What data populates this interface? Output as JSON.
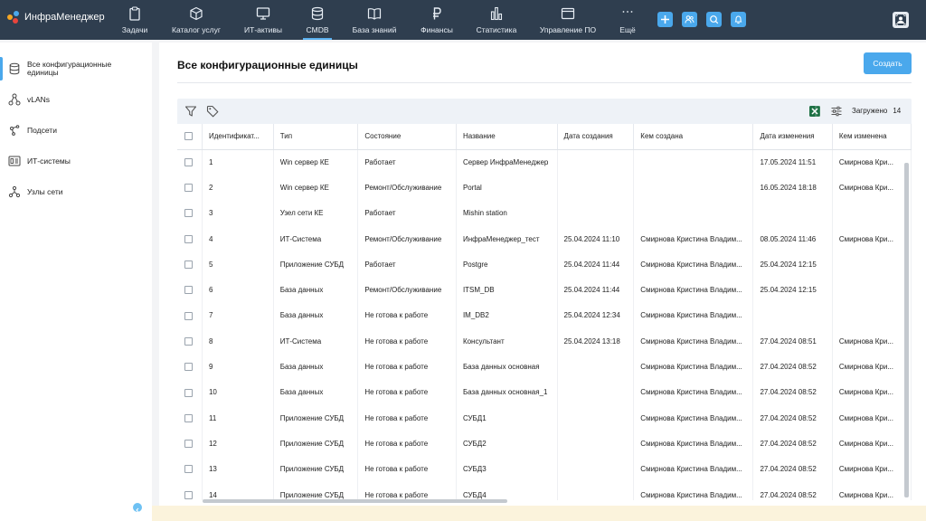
{
  "app": {
    "title": "ИнфраМенеджер"
  },
  "nav": [
    {
      "label": "Задачи",
      "icon": "clipboard-icon",
      "active": false
    },
    {
      "label": "Каталог услуг",
      "icon": "cube-icon",
      "active": false
    },
    {
      "label": "ИТ-активы",
      "icon": "monitor-icon",
      "active": false
    },
    {
      "label": "CMDB",
      "icon": "database-icon",
      "active": true
    },
    {
      "label": "База знаний",
      "icon": "book-icon",
      "active": false
    },
    {
      "label": "Финансы",
      "icon": "ruble-icon",
      "active": false
    },
    {
      "label": "Статистика",
      "icon": "bar-chart-icon",
      "active": false
    },
    {
      "label": "Управление ПО",
      "icon": "window-icon",
      "active": false
    },
    {
      "label": "Ещё",
      "icon": "more-icon",
      "active": false
    }
  ],
  "topbar_buttons": [
    "plus-icon",
    "users-icon",
    "search-icon",
    "bell-icon"
  ],
  "sidebar": {
    "items": [
      {
        "label": "Все конфигурационные единицы",
        "icon": "database-icon",
        "active": true
      },
      {
        "label": "vLANs",
        "icon": "vlan-icon",
        "active": false
      },
      {
        "label": "Подсети",
        "icon": "subnet-icon",
        "active": false
      },
      {
        "label": "ИТ-системы",
        "icon": "it-system-icon",
        "active": false
      },
      {
        "label": "Узлы сети",
        "icon": "network-node-icon",
        "active": false
      }
    ]
  },
  "main": {
    "title": "Все конфигурационные единицы",
    "create_label": "Создать",
    "loaded_label": "Загружено",
    "loaded_count": "14"
  },
  "colors": {
    "topbar": "#2f3e4f",
    "accent": "#4aa8ec",
    "excel": "#1e7145"
  },
  "table": {
    "columns": [
      "Идентификат...",
      "Тип",
      "Состояние",
      "Название",
      "Дата создания",
      "Кем создана",
      "Дата изменения",
      "Кем изменена"
    ],
    "rows": [
      [
        "1",
        "Win сервер КЕ",
        "Работает",
        "Сервер ИнфраМенеджер",
        "",
        "",
        "17.05.2024 11:51",
        "Смирнова Кри..."
      ],
      [
        "2",
        "Win сервер КЕ",
        "Ремонт/Обслуживание",
        "Portal",
        "",
        "",
        "16.05.2024 18:18",
        "Смирнова Кри..."
      ],
      [
        "3",
        "Узел сети КЕ",
        "Работает",
        "Mishin station",
        "",
        "",
        "",
        ""
      ],
      [
        "4",
        "ИТ-Система",
        "Ремонт/Обслуживание",
        "ИнфраМенеджер_тест",
        "25.04.2024 11:10",
        "Смирнова Кристина Владим...",
        "08.05.2024 11:46",
        "Смирнова Кри..."
      ],
      [
        "5",
        "Приложение СУБД",
        "Работает",
        "Postgre",
        "25.04.2024 11:44",
        "Смирнова Кристина Владим...",
        "25.04.2024 12:15",
        ""
      ],
      [
        "6",
        "База данных",
        "Ремонт/Обслуживание",
        "ITSM_DB",
        "25.04.2024 11:44",
        "Смирнова Кристина Владим...",
        "25.04.2024 12:15",
        ""
      ],
      [
        "7",
        "База данных",
        "Не готова к работе",
        "IM_DB2",
        "25.04.2024 12:34",
        "Смирнова Кристина Владим...",
        "",
        ""
      ],
      [
        "8",
        "ИТ-Система",
        "Не готова к работе",
        "Консультант",
        "25.04.2024 13:18",
        "Смирнова Кристина Владим...",
        "27.04.2024 08:51",
        "Смирнова Кри..."
      ],
      [
        "9",
        "База данных",
        "Не готова к работе",
        "База данных основная",
        "",
        "Смирнова Кристина Владим...",
        "27.04.2024 08:52",
        "Смирнова Кри..."
      ],
      [
        "10",
        "База данных",
        "Не готова к работе",
        "База данных основная_1",
        "",
        "Смирнова Кристина Владим...",
        "27.04.2024 08:52",
        "Смирнова Кри..."
      ],
      [
        "11",
        "Приложение СУБД",
        "Не готова к работе",
        "СУБД1",
        "",
        "Смирнова Кристина Владим...",
        "27.04.2024 08:52",
        "Смирнова Кри..."
      ],
      [
        "12",
        "Приложение СУБД",
        "Не готова к работе",
        "СУБД2",
        "",
        "Смирнова Кристина Владим...",
        "27.04.2024 08:52",
        "Смирнова Кри..."
      ],
      [
        "13",
        "Приложение СУБД",
        "Не готова к работе",
        "СУБД3",
        "",
        "Смирнова Кристина Владим...",
        "27.04.2024 08:52",
        "Смирнова Кри..."
      ],
      [
        "14",
        "Приложение СУБД",
        "Не готова к работе",
        "СУБД4",
        "",
        "Смирнова Кристина Владим...",
        "27.04.2024 08:52",
        "Смирнова Кри..."
      ]
    ]
  }
}
